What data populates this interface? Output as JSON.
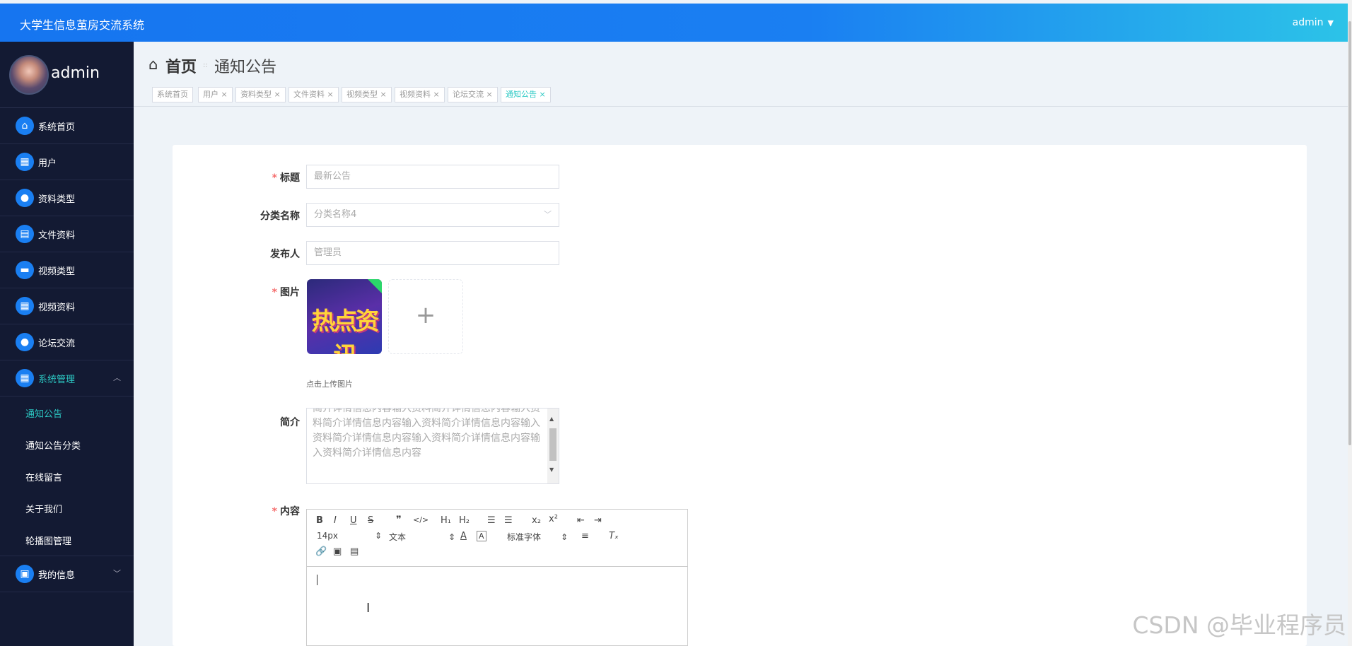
{
  "app": {
    "title": "大学生信息茧房交流系统",
    "user_menu_label": "admin"
  },
  "sidebar": {
    "profile_name": "admin",
    "items": [
      {
        "label": "系统首页",
        "icon": "home-icon"
      },
      {
        "label": "用户",
        "icon": "grid-icon"
      },
      {
        "label": "资料类型",
        "icon": "person-icon"
      },
      {
        "label": "文件资料",
        "icon": "clipboard-icon"
      },
      {
        "label": "视频类型",
        "icon": "chat-icon"
      },
      {
        "label": "视频资料",
        "icon": "grid-icon"
      },
      {
        "label": "论坛交流",
        "icon": "bulb-icon"
      },
      {
        "label": "系统管理",
        "icon": "grid-icon"
      }
    ],
    "submenu": [
      "通知公告",
      "通知公告分类",
      "在线留言",
      "关于我们",
      "轮播图管理"
    ],
    "last_item": {
      "label": "我的信息",
      "icon": "calendar-icon"
    }
  },
  "breadcrumb": {
    "home": "首页",
    "separator": "::",
    "current": "通知公告"
  },
  "tags": [
    {
      "label": "系统首页"
    },
    {
      "label": "用户"
    },
    {
      "label": "资料类型"
    },
    {
      "label": "文件资料"
    },
    {
      "label": "视频类型"
    },
    {
      "label": "视频资料"
    },
    {
      "label": "论坛交流"
    },
    {
      "label": "通知公告"
    }
  ],
  "form": {
    "title_label": "标题",
    "title_placeholder": "最新公告",
    "category_label": "分类名称",
    "category_value": "分类名称4",
    "publisher_label": "发布人",
    "publisher_value": "管理员",
    "image_label": "图片",
    "image_text": "热点资讯",
    "upload_tip": "点击上传图片",
    "intro_label": "简介",
    "intro_text": "简介详情信息内容输入资料简介详情信息内容输入资料简介详情信息内容输入资料简介详情信息内容输入资料简介详情信息内容输入资料简介详情信息内容输入资料简介详情信息内容",
    "content_label": "内容",
    "font_size": "14px",
    "text_style": "文本",
    "font_family": "标准字体"
  },
  "watermark": "CSDN @毕业程序员"
}
